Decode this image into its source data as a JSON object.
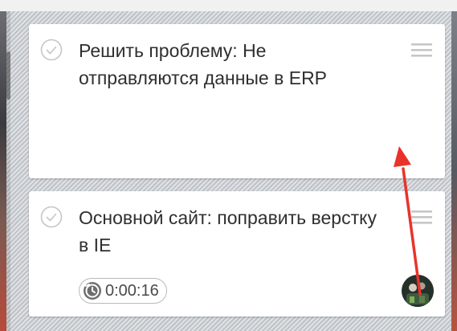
{
  "board": {
    "cards": [
      {
        "title": "Решить проблему: Не отправляются данные в ERP",
        "check_icon": "check-circle-icon",
        "menu_icon": "menu-icon"
      },
      {
        "title": "Основной сайт: поправить верстку в IE",
        "check_icon": "check-circle-icon",
        "menu_icon": "menu-icon",
        "timer": {
          "icon": "timer-icon",
          "value": "0:00:16"
        },
        "assignee_avatar": "avatar"
      }
    ]
  },
  "colors": {
    "annotation_arrow": "#e8332a",
    "card_background": "#ffffff",
    "title_text": "#2f2f2f",
    "icon_gray": "#c6c6c6",
    "timer_icon": "#6e6e6e"
  }
}
